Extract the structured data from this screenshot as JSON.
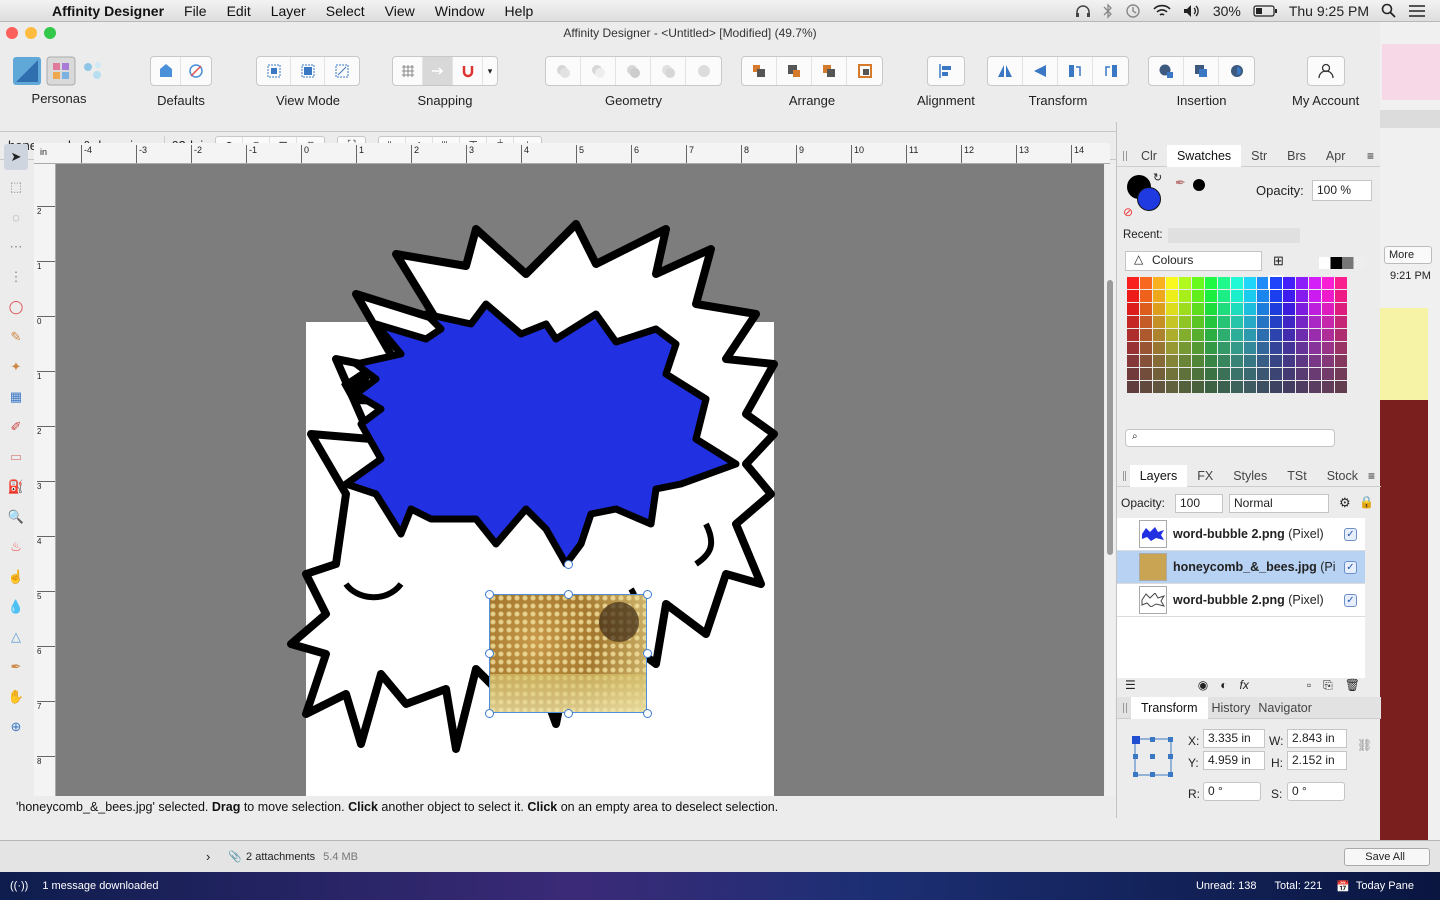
{
  "menubar": {
    "app": "Affinity Designer",
    "items": [
      "File",
      "Edit",
      "Layer",
      "Select",
      "View",
      "Window",
      "Help"
    ],
    "battery": "30%",
    "clock": "Thu 9:25 PM"
  },
  "window": {
    "title": "Affinity Designer - <Untitled> [Modified] (49.7%)"
  },
  "toolbar": {
    "personas": "Personas",
    "defaults": "Defaults",
    "view_mode": "View Mode",
    "snapping": "Snapping",
    "geometry": "Geometry",
    "arrange": "Arrange",
    "alignment": "Alignment",
    "transform": "Transform",
    "insertion": "Insertion",
    "account": "My Account"
  },
  "context": {
    "filename": "honeycomb_&_bees.jpg...",
    "dpi": "62dpi"
  },
  "ruler": {
    "unit": "in",
    "h_ticks": [
      "-4",
      "-3",
      "-2",
      "-1",
      "0",
      "1",
      "2",
      "3",
      "4",
      "5",
      "6",
      "7",
      "8",
      "9",
      "10",
      "11",
      "12",
      "13",
      "14"
    ],
    "v_ticks": [
      "2",
      "1",
      "0",
      "1",
      "2",
      "3",
      "4",
      "5",
      "6",
      "7",
      "8"
    ]
  },
  "status": {
    "q": "'honeycomb_&_bees.jpg' selected. ",
    "b1": "Drag",
    "t1": " to move selection. ",
    "b2": "Click",
    "t2": " another object to select it. ",
    "b3": "Click",
    "t3": " on an empty area to deselect selection."
  },
  "colour_panel": {
    "tabs": [
      "Clr",
      "Swatches",
      "Str",
      "Brs",
      "Apr"
    ],
    "opacity_label": "Opacity:",
    "opacity": "100 %",
    "recent_label": "Recent:",
    "palette": "Colours"
  },
  "layers_panel": {
    "tabs": [
      "Layers",
      "FX",
      "Styles",
      "TSt",
      "Stock"
    ],
    "opacity_label": "Opacity:",
    "opacity": "100",
    "blend": "Normal",
    "layers": [
      {
        "name": "word-bubble 2.png",
        "type": " (Pixel)"
      },
      {
        "name": "honeycomb_&_bees.jpg",
        "type": " (Pi"
      },
      {
        "name": "word-bubble 2.png",
        "type": " (Pixel)"
      }
    ]
  },
  "transform_panel": {
    "tabs": [
      "Transform",
      "History",
      "Navigator"
    ],
    "x_label": "X:",
    "x": "3.335 in",
    "y_label": "Y:",
    "y": "4.959 in",
    "w_label": "W:",
    "w": "2.843 in",
    "h_label": "H:",
    "h": "2.152 in",
    "r_label": "R:",
    "r": "0 °",
    "s_label": "S:",
    "s": "0 °"
  },
  "mail": {
    "attachments": "2 attachments",
    "size": "5.4 MB",
    "save": "Save All",
    "more": "More",
    "time": "9:21 PM"
  },
  "dock": {
    "message": "1 message downloaded",
    "unread": "Unread: 138",
    "total": "Total: 221",
    "today": "Today Pane"
  }
}
